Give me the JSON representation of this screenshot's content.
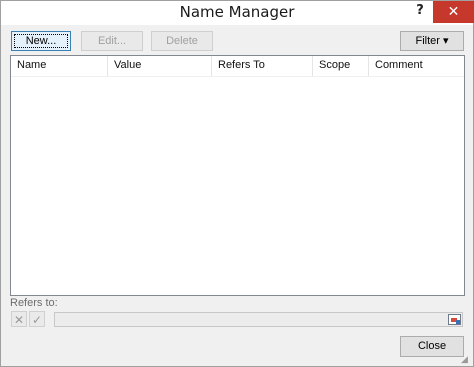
{
  "window": {
    "title": "Name Manager",
    "help": "?",
    "close": "✕"
  },
  "toolbar": {
    "new_label": "New...",
    "edit_label": "Edit...",
    "delete_label": "Delete",
    "filter_label": "Filter ▾"
  },
  "table": {
    "columns": [
      "Name",
      "Value",
      "Refers To",
      "Scope",
      "Comment"
    ],
    "rows": []
  },
  "refers": {
    "label": "Refers to:",
    "value": "",
    "cancel_icon": "✕",
    "confirm_icon": "✓"
  },
  "footer": {
    "close_label": "Close"
  },
  "colors": {
    "close_button": "#c7382c",
    "default_button_border": "#3c7fb1"
  }
}
